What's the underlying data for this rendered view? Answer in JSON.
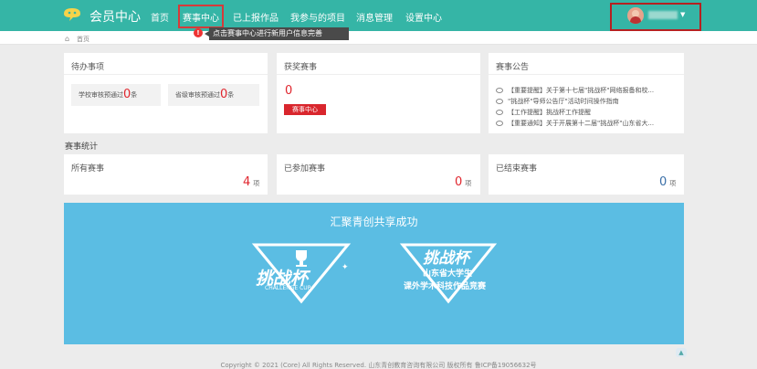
{
  "header": {
    "brand": "会员中心",
    "nav": [
      "首页",
      "赛事中心",
      "已上报作品",
      "我参与的项目",
      "消息管理",
      "设置中心"
    ]
  },
  "tooltip": {
    "badge": "!",
    "text": "点击赛事中心进行新用户信息完善"
  },
  "breadcrumb": {
    "home": "首页"
  },
  "todo": {
    "title": "待办事项",
    "school": {
      "label": "学校审核预通过",
      "count": "0",
      "unit": "条"
    },
    "province": {
      "label": "省级审核预通过",
      "count": "0",
      "unit": "条"
    }
  },
  "awards": {
    "title": "获奖赛事",
    "count": "0",
    "button": "赛事中心"
  },
  "announcements": {
    "title": "赛事公告",
    "items": [
      "【重要提醒】关于第十七届\"挑战杯\"网络报备和校...",
      "\"挑战杯\"导师公告厅\"活动时间操作指南",
      "【工作提醒】挑战杯工作提醒",
      "【重要通知】关于开展第十二届\"挑战杯\"山东省大..."
    ]
  },
  "stats": {
    "section": "赛事统计",
    "all": {
      "label": "所有赛事",
      "value": "4",
      "unit": "项"
    },
    "joined": {
      "label": "已参加赛事",
      "value": "0",
      "unit": "项"
    },
    "ended": {
      "label": "已结束赛事",
      "value": "0",
      "unit": "项"
    }
  },
  "banner": {
    "title": "汇聚青创共享成功",
    "left_logo": "挑战杯",
    "left_sub": "CHALLENGE CUP",
    "right_logo": "挑战杯",
    "right_line1": "山东省大学生",
    "right_line2": "课外学术科技作品竞赛"
  },
  "footer": "Copyright © 2021 (Core) All Rights Reserved. 山东青创教育咨询有限公司 版权所有 鲁ICP备19056632号",
  "colors": {
    "topbar": "#35b5a6",
    "accent_red": "#e0262e",
    "stat_red": "#e0262e",
    "stat_blue": "#3a6fa8",
    "banner": "#5bbde3"
  }
}
